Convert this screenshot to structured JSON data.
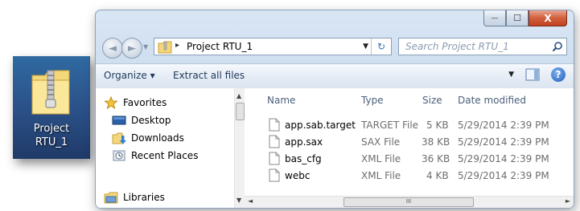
{
  "desktop_icon": {
    "line1": "Project",
    "line2": "RTU_1",
    "icon": "zip-folder-icon"
  },
  "window": {
    "caption": {
      "min": "—",
      "max": "☐",
      "close": "X"
    },
    "nav": {
      "back": "◄",
      "forward": "►",
      "history_drop": "▼"
    },
    "address": {
      "separator": "▸",
      "path": "Project RTU_1",
      "dropdown": "▼",
      "refresh": "↻"
    },
    "search": {
      "placeholder": "Search Project RTU_1"
    },
    "toolbar": {
      "organize": "Organize ▾",
      "extract": "Extract all files",
      "view_drop": "▼",
      "help": "?"
    },
    "navpane": {
      "items": [
        {
          "label": "Favorites",
          "icon": "star-icon"
        },
        {
          "label": "Desktop",
          "icon": "desktop-icon"
        },
        {
          "label": "Downloads",
          "icon": "downloads-icon"
        },
        {
          "label": "Recent Places",
          "icon": "recent-places-icon"
        },
        {
          "label": "Libraries",
          "icon": "libraries-icon"
        }
      ]
    },
    "columns": [
      "Name",
      "Type",
      "Size",
      "Date modified"
    ],
    "files": [
      {
        "name": "app.sab.target",
        "type": "TARGET File",
        "size": "5 KB",
        "date": "5/29/2014 2:39 PM"
      },
      {
        "name": "app.sax",
        "type": "SAX File",
        "size": "38 KB",
        "date": "5/29/2014 2:39 PM"
      },
      {
        "name": "bas_cfg",
        "type": "XML File",
        "size": "36 KB",
        "date": "5/29/2014 2:39 PM"
      },
      {
        "name": "webc",
        "type": "XML File",
        "size": "4 KB",
        "date": "5/29/2014 2:39 PM"
      }
    ],
    "scroll": {
      "up": "▲",
      "down": "▼",
      "left": "◄",
      "right": "►",
      "grip": "III"
    }
  }
}
